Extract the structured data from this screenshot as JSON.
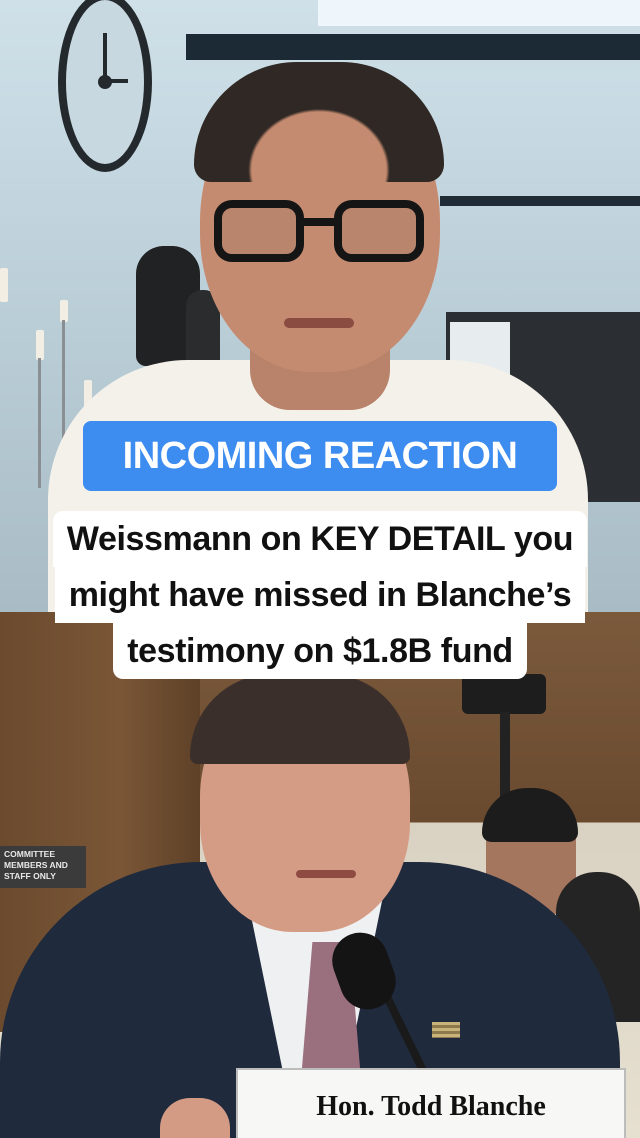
{
  "banner": {
    "label": "INCOMING REACTION",
    "color": "#3d8cf0"
  },
  "caption": {
    "lines": [
      "Weissmann on KEY DETAIL you",
      "might have missed in Blanche’s",
      "testimony on $1.8B fund"
    ]
  },
  "bottom_scene": {
    "plaque_lines": [
      "COMMITTEE",
      "MEMBERS AND",
      "STAFF ONLY"
    ],
    "nameplate": "Hon. Todd Blanche"
  }
}
